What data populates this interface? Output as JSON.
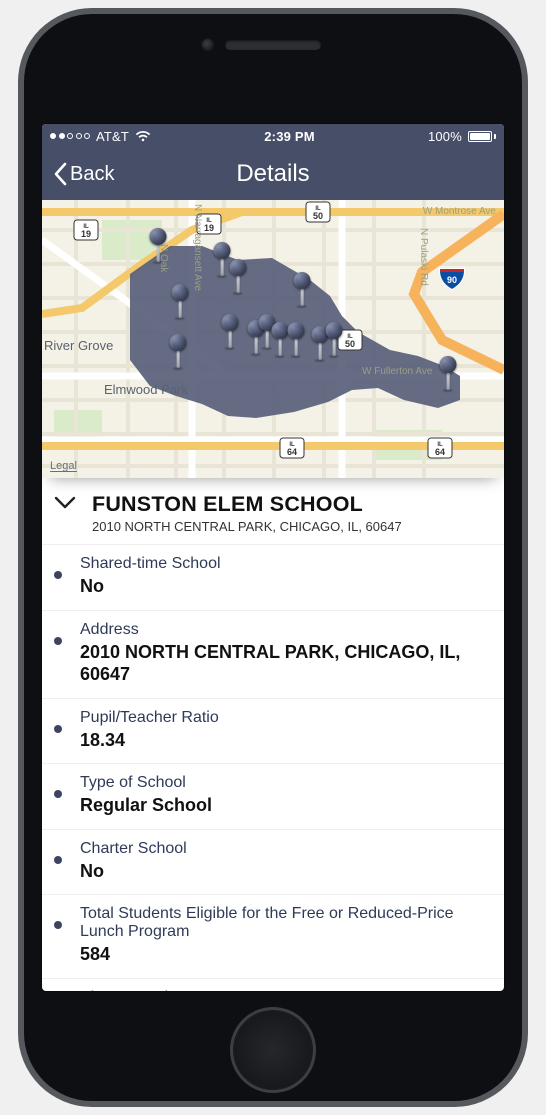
{
  "statusbar": {
    "carrier": "AT&T",
    "signal_filled": 2,
    "signal_total": 5,
    "time": "2:39 PM",
    "battery_pct": "100%"
  },
  "nav": {
    "back_label": "Back",
    "title": "Details"
  },
  "map": {
    "legal_label": "Legal",
    "places": {
      "river_grove": "River Grove",
      "elmwood_park": "Elmwood Park"
    },
    "roads": {
      "montrose": "W Montrose Ave",
      "fullerton": "W Fullerton Ave",
      "narragansett": "N Narragansett Ave",
      "oak": "N Oak",
      "pulaski": "N Pulaski Rd"
    },
    "shields": {
      "il19a": "19",
      "il19b": "19",
      "il50a": "50",
      "il50b": "50",
      "il64a": "64",
      "il64b": "64",
      "i90": "90"
    },
    "state_abbr": "IL"
  },
  "school": {
    "name": "FUNSTON ELEM SCHOOL",
    "address_line": "2010 NORTH CENTRAL PARK, CHICAGO, IL, 60647"
  },
  "details": [
    {
      "label": "Shared-time School",
      "value": "No"
    },
    {
      "label": "Address",
      "value": "2010 NORTH CENTRAL PARK, CHICAGO, IL, 60647"
    },
    {
      "label": "Pupil/Teacher Ratio",
      "value": "18.34"
    },
    {
      "label": "Type of School",
      "value": "Regular School"
    },
    {
      "label": "Charter School",
      "value": "No"
    },
    {
      "label": "Total Students Eligible for the Free or Reduced-Price Lunch Program",
      "value": "584"
    },
    {
      "label": "Phone Number",
      "value": ""
    }
  ]
}
